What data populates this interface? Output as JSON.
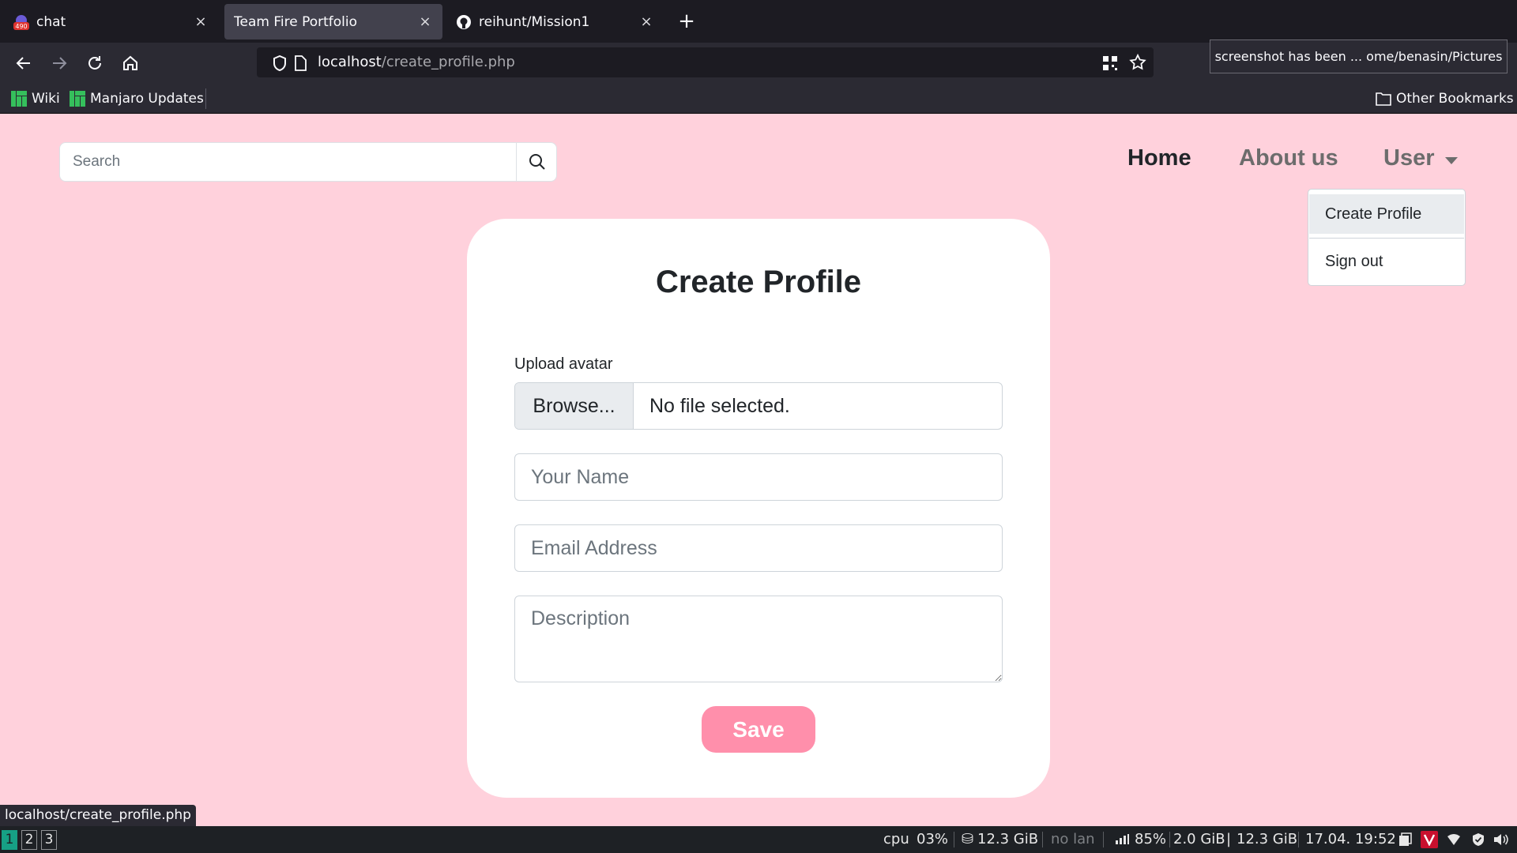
{
  "browser": {
    "tabs": [
      {
        "label": "chat",
        "badge": "490",
        "active": false
      },
      {
        "label": "Team Fire Portfolio",
        "active": true
      },
      {
        "label": "reihunt/Mission1",
        "active": false
      }
    ],
    "url_host": "localhost",
    "url_path": "/create_profile.php",
    "notification": "screenshot has been ... ome/benasin/Pictures",
    "bookmarks": [
      {
        "label": "Wiki"
      },
      {
        "label": "Manjaro Updates"
      }
    ],
    "other_bookmarks": "Other Bookmarks",
    "status_url": "localhost/create_profile.php"
  },
  "site": {
    "search": {
      "placeholder": "Search"
    },
    "nav": {
      "home": "Home",
      "about": "About us",
      "user": "User"
    },
    "dropdown": {
      "create_profile": "Create Profile",
      "sign_out": "Sign out"
    },
    "form": {
      "title": "Create Profile",
      "avatar_label": "Upload avatar",
      "browse_label": "Browse...",
      "file_status": "No file selected.",
      "name_placeholder": "Your Name",
      "email_placeholder": "Email Address",
      "description_placeholder": "Description",
      "save_label": "Save"
    },
    "colors": {
      "page_bg": "#ffd1dc",
      "save_button": "#ff8fab"
    }
  },
  "taskbar": {
    "workspaces": [
      "1",
      "2",
      "3"
    ],
    "active_workspace": "1",
    "cpu_label": "cpu",
    "cpu_value": "03%",
    "disk": "12.3 GiB",
    "network": "no lan",
    "battery": "85%",
    "mem_used": "2.0 GiB",
    "mem_total": "12.3 GiB",
    "datetime": "17.04. 19:52"
  }
}
